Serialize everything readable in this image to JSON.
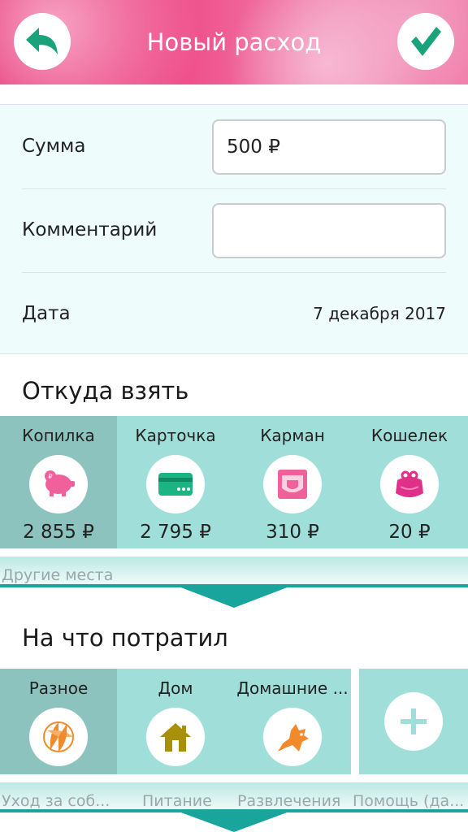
{
  "header": {
    "title": "Новый расход",
    "back_icon": "back-arrow-icon",
    "confirm_icon": "checkmark-icon",
    "accent_color": "#e31e63",
    "icon_color": "#1aa37a"
  },
  "form": {
    "amount_label": "Сумма",
    "amount_value": "500 ₽",
    "comment_label": "Комментарий",
    "comment_value": "",
    "date_label": "Дата",
    "date_value": "7 декабря 2017"
  },
  "source": {
    "title": "Откуда взять",
    "tiles": [
      {
        "name": "Копилка",
        "amount": "2 855 ₽",
        "icon": "piggy-bank-icon",
        "selected": true
      },
      {
        "name": "Карточка",
        "amount": "2 795 ₽",
        "icon": "credit-card-icon",
        "selected": false
      },
      {
        "name": "Карман",
        "amount": "310 ₽",
        "icon": "pocket-icon",
        "selected": false
      },
      {
        "name": "Кошелек",
        "amount": "20 ₽",
        "icon": "purse-icon",
        "selected": false
      }
    ],
    "more_label": "Другие места"
  },
  "spend": {
    "title": "На что потратил",
    "tiles": [
      {
        "name": "Разное",
        "icon": "beach-ball-icon",
        "selected": true
      },
      {
        "name": "Дом",
        "icon": "house-icon",
        "selected": false
      },
      {
        "name": "Домашние ...",
        "icon": "pets-icon",
        "selected": false
      }
    ],
    "add_icon": "plus-icon",
    "more_categories": [
      "Уход за соб...",
      "Питание",
      "Развлечения",
      "Помощь (да..."
    ]
  },
  "colors": {
    "tile_bg": "#a0dfd9",
    "tile_selected": "#8cc3be",
    "teal_line": "#1aa59c",
    "pink_icon": "#f0609a"
  }
}
